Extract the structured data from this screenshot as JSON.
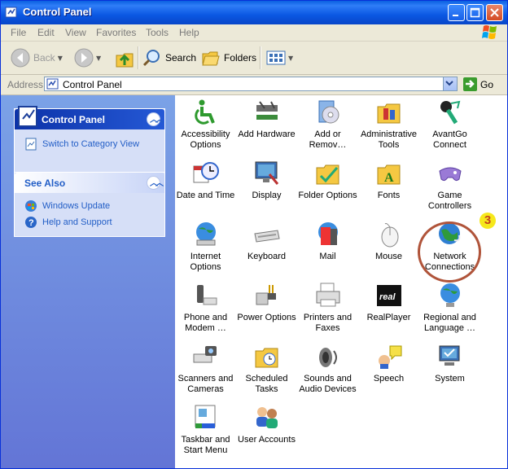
{
  "window": {
    "title": "Control Panel"
  },
  "menu": [
    "File",
    "Edit",
    "View",
    "Favorites",
    "Tools",
    "Help"
  ],
  "toolbar": {
    "back": "Back",
    "search": "Search",
    "folders": "Folders"
  },
  "address": {
    "label": "Address",
    "value": "Control Panel",
    "go": "Go"
  },
  "left_pane": {
    "control_panel": {
      "title": "Control Panel",
      "link": "Switch to Category View"
    },
    "see_also": {
      "title": "See Also",
      "links": [
        "Windows Update",
        "Help and Support"
      ]
    }
  },
  "items": [
    {
      "label": "Accessibility Options",
      "icon": "accessibility-icon"
    },
    {
      "label": "Add Hardware",
      "icon": "add-hardware-icon"
    },
    {
      "label": "Add or Remov…",
      "icon": "add-remove-programs-icon"
    },
    {
      "label": "Administrative Tools",
      "icon": "administrative-tools-icon"
    },
    {
      "label": "AvantGo Connect",
      "icon": "avantgo-icon"
    },
    {
      "label": "Date and Time",
      "icon": "date-time-icon"
    },
    {
      "label": "Display",
      "icon": "display-icon"
    },
    {
      "label": "Folder Options",
      "icon": "folder-options-icon"
    },
    {
      "label": "Fonts",
      "icon": "fonts-icon"
    },
    {
      "label": "Game Controllers",
      "icon": "game-controllers-icon"
    },
    {
      "label": "Internet Options",
      "icon": "internet-options-icon"
    },
    {
      "label": "Keyboard",
      "icon": "keyboard-icon"
    },
    {
      "label": "Mail",
      "icon": "mail-icon"
    },
    {
      "label": "Mouse",
      "icon": "mouse-icon"
    },
    {
      "label": "Network Connections",
      "icon": "network-connections-icon"
    },
    {
      "label": "Phone and Modem …",
      "icon": "phone-modem-icon"
    },
    {
      "label": "Power Options",
      "icon": "power-options-icon"
    },
    {
      "label": "Printers and Faxes",
      "icon": "printers-icon"
    },
    {
      "label": "RealPlayer",
      "icon": "realplayer-icon"
    },
    {
      "label": "Regional and Language …",
      "icon": "regional-language-icon"
    },
    {
      "label": "Scanners and Cameras",
      "icon": "scanners-icon"
    },
    {
      "label": "Scheduled Tasks",
      "icon": "scheduled-tasks-icon"
    },
    {
      "label": "Sounds and Audio Devices",
      "icon": "sounds-icon"
    },
    {
      "label": "Speech",
      "icon": "speech-icon"
    },
    {
      "label": "System",
      "icon": "system-icon"
    },
    {
      "label": "Taskbar and Start Menu",
      "icon": "taskbar-icon"
    },
    {
      "label": "User Accounts",
      "icon": "user-accounts-icon"
    }
  ],
  "annotation": {
    "number": "3",
    "color": "#b0543a",
    "badge_color": "#f6e81c"
  }
}
